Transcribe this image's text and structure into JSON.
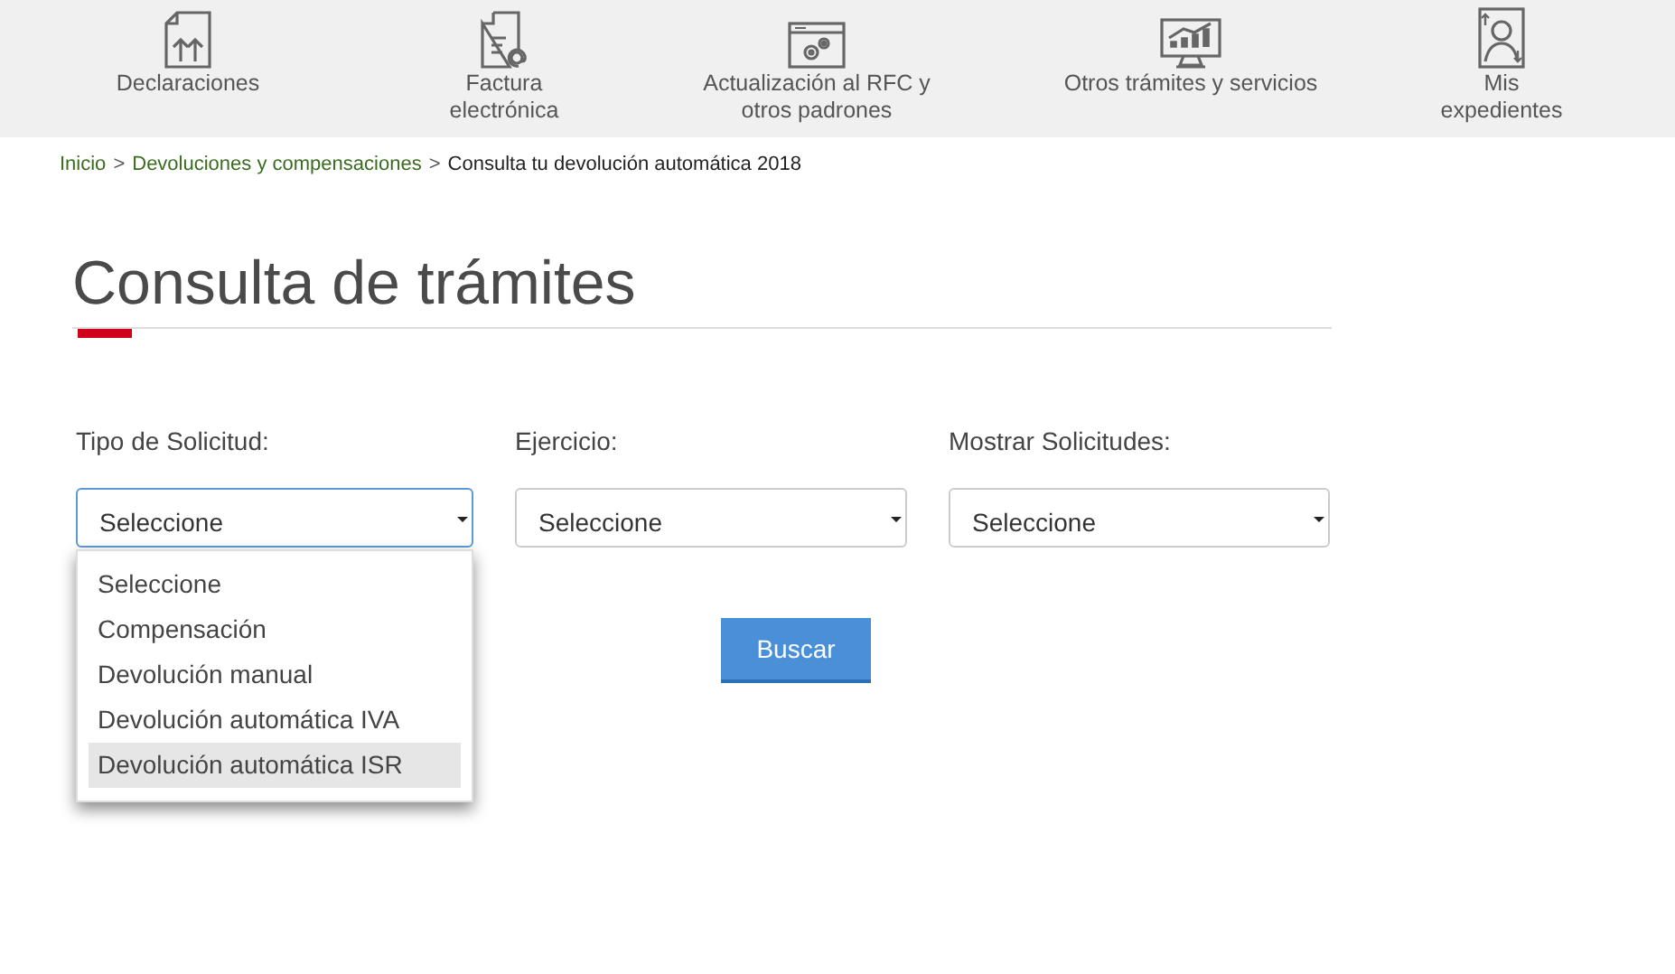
{
  "nav": [
    {
      "label": "Declaraciones"
    },
    {
      "label": "Factura electrónica"
    },
    {
      "label": "Actualización al RFC y otros padrones"
    },
    {
      "label": "Otros trámites y servicios"
    },
    {
      "label": "Mis expedientes"
    }
  ],
  "breadcrumb": [
    {
      "text": "Inicio",
      "kind": "link"
    },
    {
      "text": ">",
      "kind": "separator"
    },
    {
      "text": "Devoluciones y compensaciones",
      "kind": "link"
    },
    {
      "text": ">",
      "kind": "separator"
    },
    {
      "text": "Consulta tu devolución automática 2018",
      "kind": "current"
    }
  ],
  "title": "Consulta de trámites",
  "filters": [
    {
      "label": "Tipo de Solicitud:",
      "value": "Seleccione",
      "focused": true
    },
    {
      "label": "Ejercicio:",
      "value": "Seleccione",
      "focused": false
    },
    {
      "label": "Mostrar Solicitudes:",
      "value": "Seleccione",
      "focused": false
    }
  ],
  "dropdown": {
    "options": [
      {
        "label": "Seleccione",
        "selected": false
      },
      {
        "label": "Compensación",
        "selected": false
      },
      {
        "label": "Devolución manual",
        "selected": false
      },
      {
        "label": "Devolución automática IVA",
        "selected": false
      },
      {
        "label": "Devolución automática ISR",
        "selected": true
      }
    ]
  },
  "button": "Buscar"
}
